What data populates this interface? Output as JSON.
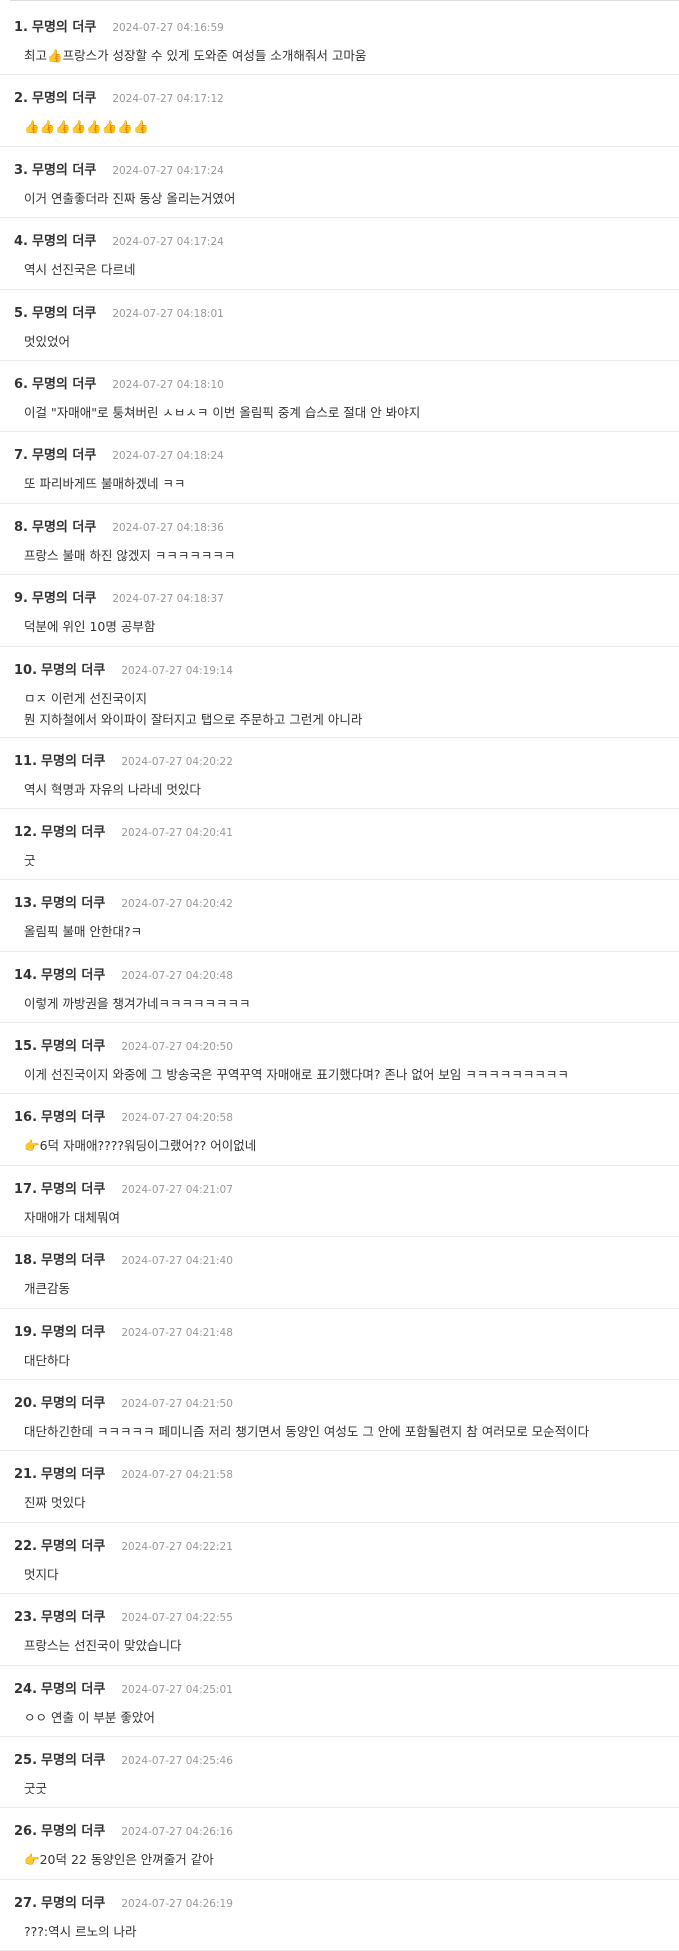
{
  "comments": [
    {
      "num": "1.",
      "author": "무명의 더쿠",
      "time": "2024-07-27 04:16:59",
      "text": "최고👍프랑스가 성장할 수 있게 도와준 여성들 소개해줘서 고마움"
    },
    {
      "num": "2.",
      "author": "무명의 더쿠",
      "time": "2024-07-27 04:17:12",
      "text": "👍👍👍👍👍👍👍👍"
    },
    {
      "num": "3.",
      "author": "무명의 더쿠",
      "time": "2024-07-27 04:17:24",
      "text": "이거 연출좋더라 진짜 동상 올리는거였어"
    },
    {
      "num": "4.",
      "author": "무명의 더쿠",
      "time": "2024-07-27 04:17:24",
      "text": "역시 선진국은 다르네"
    },
    {
      "num": "5.",
      "author": "무명의 더쿠",
      "time": "2024-07-27 04:18:01",
      "text": "멋있었어"
    },
    {
      "num": "6.",
      "author": "무명의 더쿠",
      "time": "2024-07-27 04:18:10",
      "text": "이걸 \"자매애\"로 퉁쳐버린 ㅅㅂㅅㅋ 이번 올림픽 중계 습스로 절대 안 봐야지"
    },
    {
      "num": "7.",
      "author": "무명의 더쿠",
      "time": "2024-07-27 04:18:24",
      "text": "또 파리바게뜨 불매하겠네 ㅋㅋ"
    },
    {
      "num": "8.",
      "author": "무명의 더쿠",
      "time": "2024-07-27 04:18:36",
      "text": "프랑스 불매 하진 않겠지 ㅋㅋㅋㅋㅋㅋㅋ"
    },
    {
      "num": "9.",
      "author": "무명의 더쿠",
      "time": "2024-07-27 04:18:37",
      "text": "덕분에 위인 10명 공부함"
    },
    {
      "num": "10.",
      "author": "무명의 더쿠",
      "time": "2024-07-27 04:19:14",
      "text": "ㅁㅈ 이런게 선진국이지\n뭔 지하철에서 와이파이 잘터지고 탭으로 주문하고 그런게 아니라"
    },
    {
      "num": "11.",
      "author": "무명의 더쿠",
      "time": "2024-07-27 04:20:22",
      "text": "역시 혁명과 자유의 나라네 멋있다"
    },
    {
      "num": "12.",
      "author": "무명의 더쿠",
      "time": "2024-07-27 04:20:41",
      "text": "굿"
    },
    {
      "num": "13.",
      "author": "무명의 더쿠",
      "time": "2024-07-27 04:20:42",
      "text": "올림픽 불매 안한대?ㅋ"
    },
    {
      "num": "14.",
      "author": "무명의 더쿠",
      "time": "2024-07-27 04:20:48",
      "text": "이렇게 까방권을 챙겨가네ㅋㅋㅋㅋㅋㅋㅋㅋ"
    },
    {
      "num": "15.",
      "author": "무명의 더쿠",
      "time": "2024-07-27 04:20:50",
      "text": "이게 선진국이지 와중에 그 방송국은 꾸역꾸역 자매애로 표기했다며? 존나 없어 보임 ㅋㅋㅋㅋㅋㅋㅋㅋㅋ"
    },
    {
      "num": "16.",
      "author": "무명의 더쿠",
      "time": "2024-07-27 04:20:58",
      "text": "👉6덕 자매애????워딩이그랬어?? 어이없네"
    },
    {
      "num": "17.",
      "author": "무명의 더쿠",
      "time": "2024-07-27 04:21:07",
      "text": "자매애가 대체뭐여"
    },
    {
      "num": "18.",
      "author": "무명의 더쿠",
      "time": "2024-07-27 04:21:40",
      "text": "개큰감동"
    },
    {
      "num": "19.",
      "author": "무명의 더쿠",
      "time": "2024-07-27 04:21:48",
      "text": "대단하다"
    },
    {
      "num": "20.",
      "author": "무명의 더쿠",
      "time": "2024-07-27 04:21:50",
      "text": "대단하긴한데 ㅋㅋㅋㅋㅋ 페미니즘 저리 챙기면서 동양인 여성도 그 안에 포함될련지 참 여러모로 모순적이다"
    },
    {
      "num": "21.",
      "author": "무명의 더쿠",
      "time": "2024-07-27 04:21:58",
      "text": "진짜 멋있다"
    },
    {
      "num": "22.",
      "author": "무명의 더쿠",
      "time": "2024-07-27 04:22:21",
      "text": "멋지다"
    },
    {
      "num": "23.",
      "author": "무명의 더쿠",
      "time": "2024-07-27 04:22:55",
      "text": "프랑스는 선진국이 맞았습니다"
    },
    {
      "num": "24.",
      "author": "무명의 더쿠",
      "time": "2024-07-27 04:25:01",
      "text": "ㅇㅇ 연출 이 부분 좋았어"
    },
    {
      "num": "25.",
      "author": "무명의 더쿠",
      "time": "2024-07-27 04:25:46",
      "text": "굿굿"
    },
    {
      "num": "26.",
      "author": "무명의 더쿠",
      "time": "2024-07-27 04:26:16",
      "text": "👉20덕 22 동양인은 안껴줄거 같아"
    },
    {
      "num": "27.",
      "author": "무명의 더쿠",
      "time": "2024-07-27 04:26:19",
      "text": "???:역시 르노의 나라"
    }
  ]
}
